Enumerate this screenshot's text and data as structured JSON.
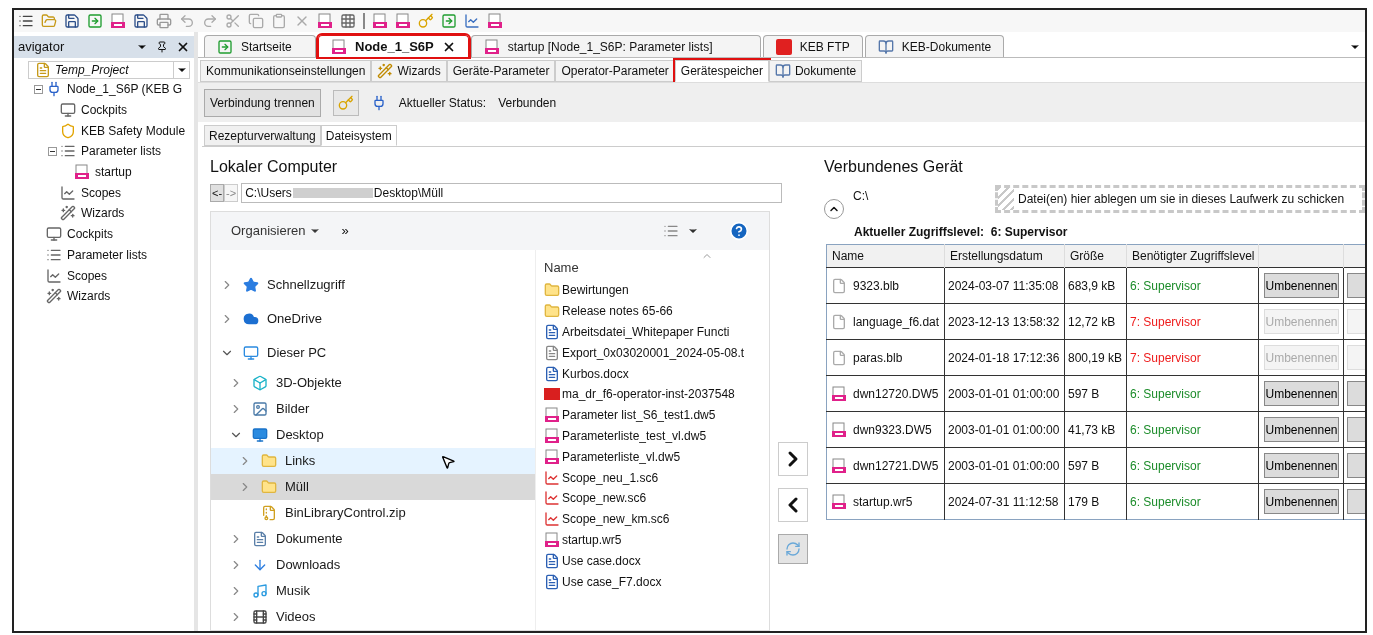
{
  "navigator": {
    "title": "avigator",
    "project": "Temp_Project",
    "tree": [
      {
        "label": "Node_1_S6P (KEB G",
        "kind": "device",
        "expanded": true,
        "children": [
          {
            "label": "Cockpits",
            "kind": "cockpits"
          },
          {
            "label": "KEB Safety Module",
            "kind": "safety"
          },
          {
            "label": "Parameter lists",
            "kind": "parameters",
            "expanded": true,
            "children": [
              {
                "label": "startup",
                "kind": "keb-file"
              }
            ]
          },
          {
            "label": "Scopes",
            "kind": "scopes"
          },
          {
            "label": "Wizards",
            "kind": "wizards"
          }
        ]
      },
      {
        "label": "Cockpits",
        "kind": "cockpits"
      },
      {
        "label": "Parameter lists",
        "kind": "parameters"
      },
      {
        "label": "Scopes",
        "kind": "scopes"
      },
      {
        "label": "Wizards",
        "kind": "wizards"
      }
    ]
  },
  "document_tabs": [
    {
      "label": "Startseite",
      "kind": "home",
      "selected": false,
      "highlighted": false,
      "closable": false
    },
    {
      "label": "Node_1_S6P",
      "kind": "device",
      "selected": true,
      "highlighted": true,
      "closable": true
    },
    {
      "label": "startup [Node_1_S6P: Parameter lists]",
      "kind": "keb-file",
      "selected": false,
      "highlighted": false,
      "closable": false
    },
    {
      "label": "KEB FTP",
      "kind": "ftp",
      "selected": false,
      "highlighted": false,
      "closable": false
    },
    {
      "label": "KEB-Dokumente",
      "kind": "book",
      "selected": false,
      "highlighted": false,
      "closable": false
    }
  ],
  "device_tabs": [
    {
      "label": "Kommunikationseinstellungen",
      "kind": "plain",
      "selected": false,
      "highlighted": false
    },
    {
      "label": "Wizards",
      "kind": "wand",
      "selected": false,
      "highlighted": false
    },
    {
      "label": "Geräte-Parameter",
      "kind": "plain",
      "selected": false,
      "highlighted": false
    },
    {
      "label": "Operator-Parameter",
      "kind": "plain",
      "selected": false,
      "highlighted": false
    },
    {
      "label": "Gerätespeicher",
      "kind": "plain",
      "selected": true,
      "highlighted": true
    },
    {
      "label": "Dokumente",
      "kind": "book",
      "selected": false,
      "highlighted": false
    }
  ],
  "connection": {
    "button": "Verbindung trennen",
    "status_label": "Aktueller Status:",
    "status": "Verbunden"
  },
  "memory_tabs": [
    {
      "label": "Rezepturverwaltung",
      "selected": false
    },
    {
      "label": "Dateisystem",
      "selected": true
    }
  ],
  "local": {
    "title": "Lokaler Computer",
    "back": "<-",
    "forward": "->",
    "path_start": "C:\\Users",
    "path_end": "Desktop\\Müll",
    "organize": "Organisieren",
    "more": "»",
    "nav": [
      {
        "label": "Schnellzugriff",
        "kind": "quick",
        "expanded": false,
        "selected": false,
        "hovered": false
      },
      {
        "label": "OneDrive",
        "kind": "cloud",
        "expanded": false,
        "selected": false,
        "hovered": false
      },
      {
        "label": "Dieser PC",
        "kind": "pc",
        "expanded": true,
        "selected": false,
        "hovered": false,
        "children": [
          {
            "label": "3D-Objekte",
            "kind": "cube",
            "expanded": false,
            "selected": false,
            "hovered": false
          },
          {
            "label": "Bilder",
            "kind": "pictures",
            "expanded": false,
            "selected": false,
            "hovered": false
          },
          {
            "label": "Desktop",
            "kind": "desktop",
            "expanded": true,
            "selected": false,
            "hovered": false,
            "children": [
              {
                "label": "Links",
                "kind": "folder",
                "expanded": false,
                "selected": false,
                "hovered": true
              },
              {
                "label": "Müll",
                "kind": "folder",
                "expanded": false,
                "selected": true,
                "hovered": false
              },
              {
                "label": "BinLibraryControl.zip",
                "kind": "zip",
                "selected": false,
                "hovered": false
              }
            ]
          },
          {
            "label": "Dokumente",
            "kind": "documents",
            "expanded": false,
            "selected": false,
            "hovered": false
          },
          {
            "label": "Downloads",
            "kind": "downloads",
            "expanded": false,
            "selected": false,
            "hovered": false
          },
          {
            "label": "Musik",
            "kind": "music",
            "expanded": false,
            "selected": false,
            "hovered": false
          },
          {
            "label": "Videos",
            "kind": "videos",
            "expanded": false,
            "selected": false,
            "hovered": false
          }
        ]
      }
    ],
    "column": "Name",
    "files": [
      {
        "name": "Bewirtungen",
        "kind": "folder"
      },
      {
        "name": "Release notes  65-66",
        "kind": "folder"
      },
      {
        "name": "Arbeitsdatei_Whitepaper Functi",
        "kind": "word"
      },
      {
        "name": "Export_0x03020001_2024-05-08.t",
        "kind": "text"
      },
      {
        "name": "Kurbos.docx",
        "kind": "word"
      },
      {
        "name": "ma_dr_f6-operator-inst-2037548",
        "kind": "pdf"
      },
      {
        "name": "Parameter list_S6_test1.dw5",
        "kind": "keb"
      },
      {
        "name": "Parameterliste_test_vl.dw5",
        "kind": "keb"
      },
      {
        "name": "Parameterliste_vl.dw5",
        "kind": "keb"
      },
      {
        "name": "Scope_neu_1.sc6",
        "kind": "scope"
      },
      {
        "name": "Scope_new.sc6",
        "kind": "scope"
      },
      {
        "name": "Scope_new_km.sc6",
        "kind": "scope"
      },
      {
        "name": "startup.wr5",
        "kind": "keb"
      },
      {
        "name": "Use case.docx",
        "kind": "word"
      },
      {
        "name": "Use case_F7.docx",
        "kind": "word"
      }
    ]
  },
  "device": {
    "title": "Verbundenes Gerät",
    "drive": "C:\\",
    "drop_hint": "Datei(en) hier ablegen um sie in dieses Laufwerk zu schicken",
    "level_label": "Aktueller Zugriffslevel:",
    "level": "6: Supervisor",
    "columns": [
      "Name",
      "Erstellungsdatum",
      "Größe",
      "Benötigter Zugriffslevel"
    ],
    "rows": [
      {
        "name": "9323.blb",
        "kind": "file",
        "date": "2024-03-07 11:35:08",
        "size": "683,9 kB",
        "access": "6: Supervisor",
        "permitted": true,
        "action": "Umbenennen"
      },
      {
        "name": "language_f6.dat",
        "kind": "file",
        "date": "2023-12-13 13:58:32",
        "size": "12,72 kB",
        "access": "7: Supervisor",
        "permitted": false,
        "action": "Umbenennen"
      },
      {
        "name": "paras.blb",
        "kind": "file",
        "date": "2024-01-18 17:12:36",
        "size": "800,19 kB",
        "access": "7: Supervisor",
        "permitted": false,
        "action": "Umbenennen"
      },
      {
        "name": "dwn12720.DW5",
        "kind": "keb",
        "date": "2003-01-01 01:00:00",
        "size": "597 B",
        "access": "6: Supervisor",
        "permitted": true,
        "action": "Umbenennen"
      },
      {
        "name": "dwn9323.DW5",
        "kind": "keb",
        "date": "2003-01-01 01:00:00",
        "size": "41,73 kB",
        "access": "6: Supervisor",
        "permitted": true,
        "action": "Umbenennen"
      },
      {
        "name": "dwn12721.DW5",
        "kind": "keb",
        "date": "2003-01-01 01:00:00",
        "size": "597 B",
        "access": "6: Supervisor",
        "permitted": true,
        "action": "Umbenennen"
      },
      {
        "name": "startup.wr5",
        "kind": "keb",
        "date": "2024-07-31 11:12:58",
        "size": "179 B",
        "access": "6: Supervisor",
        "permitted": true,
        "action": "Umbenennen"
      }
    ]
  }
}
